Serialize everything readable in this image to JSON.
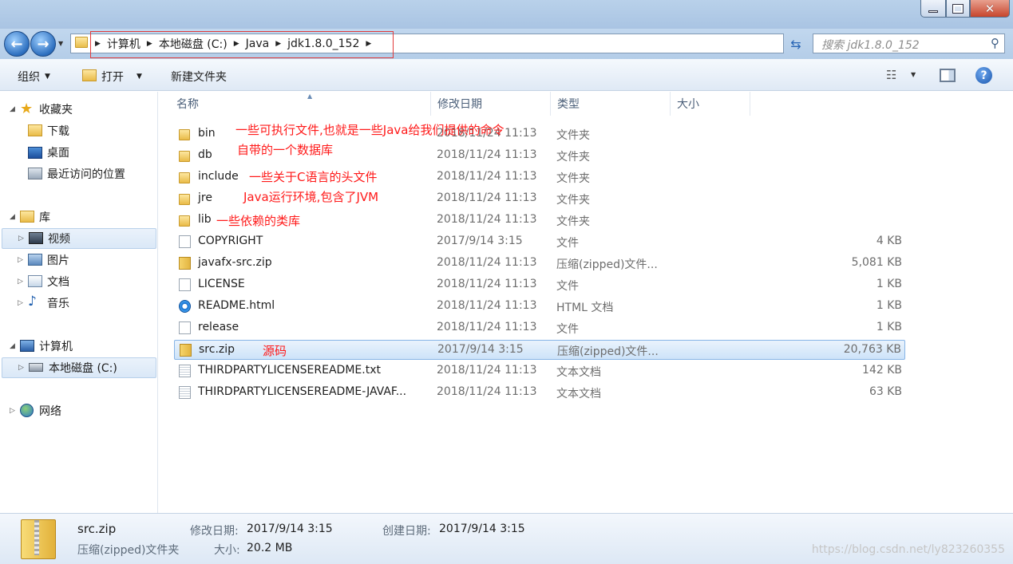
{
  "address": {
    "crumbs": [
      "计算机",
      "本地磁盘 (C:)",
      "Java",
      "jdk1.8.0_152"
    ],
    "search_placeholder": "搜索 jdk1.8.0_152"
  },
  "toolbar": {
    "organize": "组织",
    "open": "打开",
    "new_folder": "新建文件夹"
  },
  "sidebar": {
    "favorites": "收藏夹",
    "downloads": "下载",
    "desktop": "桌面",
    "recent": "最近访问的位置",
    "libraries": "库",
    "videos": "视频",
    "pictures": "图片",
    "documents": "文档",
    "music": "音乐",
    "computer": "计算机",
    "local_disk": "本地磁盘 (C:)",
    "network": "网络"
  },
  "columns": {
    "name": "名称",
    "date": "修改日期",
    "type": "类型",
    "size": "大小"
  },
  "files": [
    {
      "name": "bin",
      "date": "2018/11/24 11:13",
      "type": "文件夹",
      "size": "",
      "icon": "folder-icon"
    },
    {
      "name": "db",
      "date": "2018/11/24 11:13",
      "type": "文件夹",
      "size": "",
      "icon": "folder-icon"
    },
    {
      "name": "include",
      "date": "2018/11/24 11:13",
      "type": "文件夹",
      "size": "",
      "icon": "folder-icon"
    },
    {
      "name": "jre",
      "date": "2018/11/24 11:13",
      "type": "文件夹",
      "size": "",
      "icon": "folder-icon"
    },
    {
      "name": "lib",
      "date": "2018/11/24 11:13",
      "type": "文件夹",
      "size": "",
      "icon": "folder-icon"
    },
    {
      "name": "COPYRIGHT",
      "date": "2017/9/14 3:15",
      "type": "文件",
      "size": "4 KB",
      "icon": "file-icon"
    },
    {
      "name": "javafx-src.zip",
      "date": "2018/11/24 11:13",
      "type": "压缩(zipped)文件...",
      "size": "5,081 KB",
      "icon": "zip-icon"
    },
    {
      "name": "LICENSE",
      "date": "2018/11/24 11:13",
      "type": "文件",
      "size": "1 KB",
      "icon": "file-icon"
    },
    {
      "name": "README.html",
      "date": "2018/11/24 11:13",
      "type": "HTML 文档",
      "size": "1 KB",
      "icon": "ie-icon"
    },
    {
      "name": "release",
      "date": "2018/11/24 11:13",
      "type": "文件",
      "size": "1 KB",
      "icon": "file-icon"
    },
    {
      "name": "src.zip",
      "date": "2017/9/14 3:15",
      "type": "压缩(zipped)文件...",
      "size": "20,763 KB",
      "icon": "zip-icon",
      "selected": true
    },
    {
      "name": "THIRDPARTYLICENSEREADME.txt",
      "date": "2018/11/24 11:13",
      "type": "文本文档",
      "size": "142 KB",
      "icon": "text-file-icon"
    },
    {
      "name": "THIRDPARTYLICENSEREADME-JAVAF...",
      "date": "2018/11/24 11:13",
      "type": "文本文档",
      "size": "63 KB",
      "icon": "text-file-icon"
    }
  ],
  "annotations": {
    "bin": "一些可执行文件,也就是一些Java给我们提供的命令",
    "db": "自带的一个数据库",
    "include": "一些关于C语言的头文件",
    "jre": "Java运行环境,包含了JVM",
    "lib": "一些依赖的类库",
    "src": "源码"
  },
  "details": {
    "name": "src.zip",
    "type": "压缩(zipped)文件夹",
    "modified_label": "修改日期:",
    "modified_value": "2017/9/14 3:15",
    "created_label": "创建日期:",
    "created_value": "2017/9/14 3:15",
    "size_label": "大小:",
    "size_value": "20.2 MB"
  },
  "watermark": "https://blog.csdn.net/ly823260355",
  "colors": {
    "annotation": "#ff1a1a",
    "selection": "#cde3f9",
    "highlight_box": "#e23a3a"
  }
}
